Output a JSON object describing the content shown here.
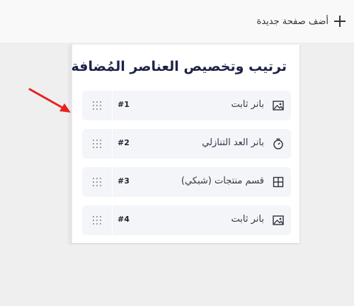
{
  "toolbar": {
    "add_page_label": "أضف صفحة جديدة",
    "add_icon": "plus-icon"
  },
  "panel": {
    "title": "ترتيب وتخصيص العناصر المُضافة"
  },
  "items": [
    {
      "index": "#1",
      "label": "بانر ثابت",
      "icon": "image-icon"
    },
    {
      "index": "#2",
      "label": "بانر العد التنازلي",
      "icon": "timer-icon"
    },
    {
      "index": "#3",
      "label": "قسم منتجات (شبكي)",
      "icon": "grid-icon"
    },
    {
      "index": "#4",
      "label": "بانر ثابت",
      "icon": "image-icon"
    }
  ],
  "colors": {
    "page_bg": "#efefef",
    "topbar_bg": "#f9f9f9",
    "item_bg": "#f3f5f8",
    "title": "#1b2346",
    "arrow": "#e8231f"
  }
}
